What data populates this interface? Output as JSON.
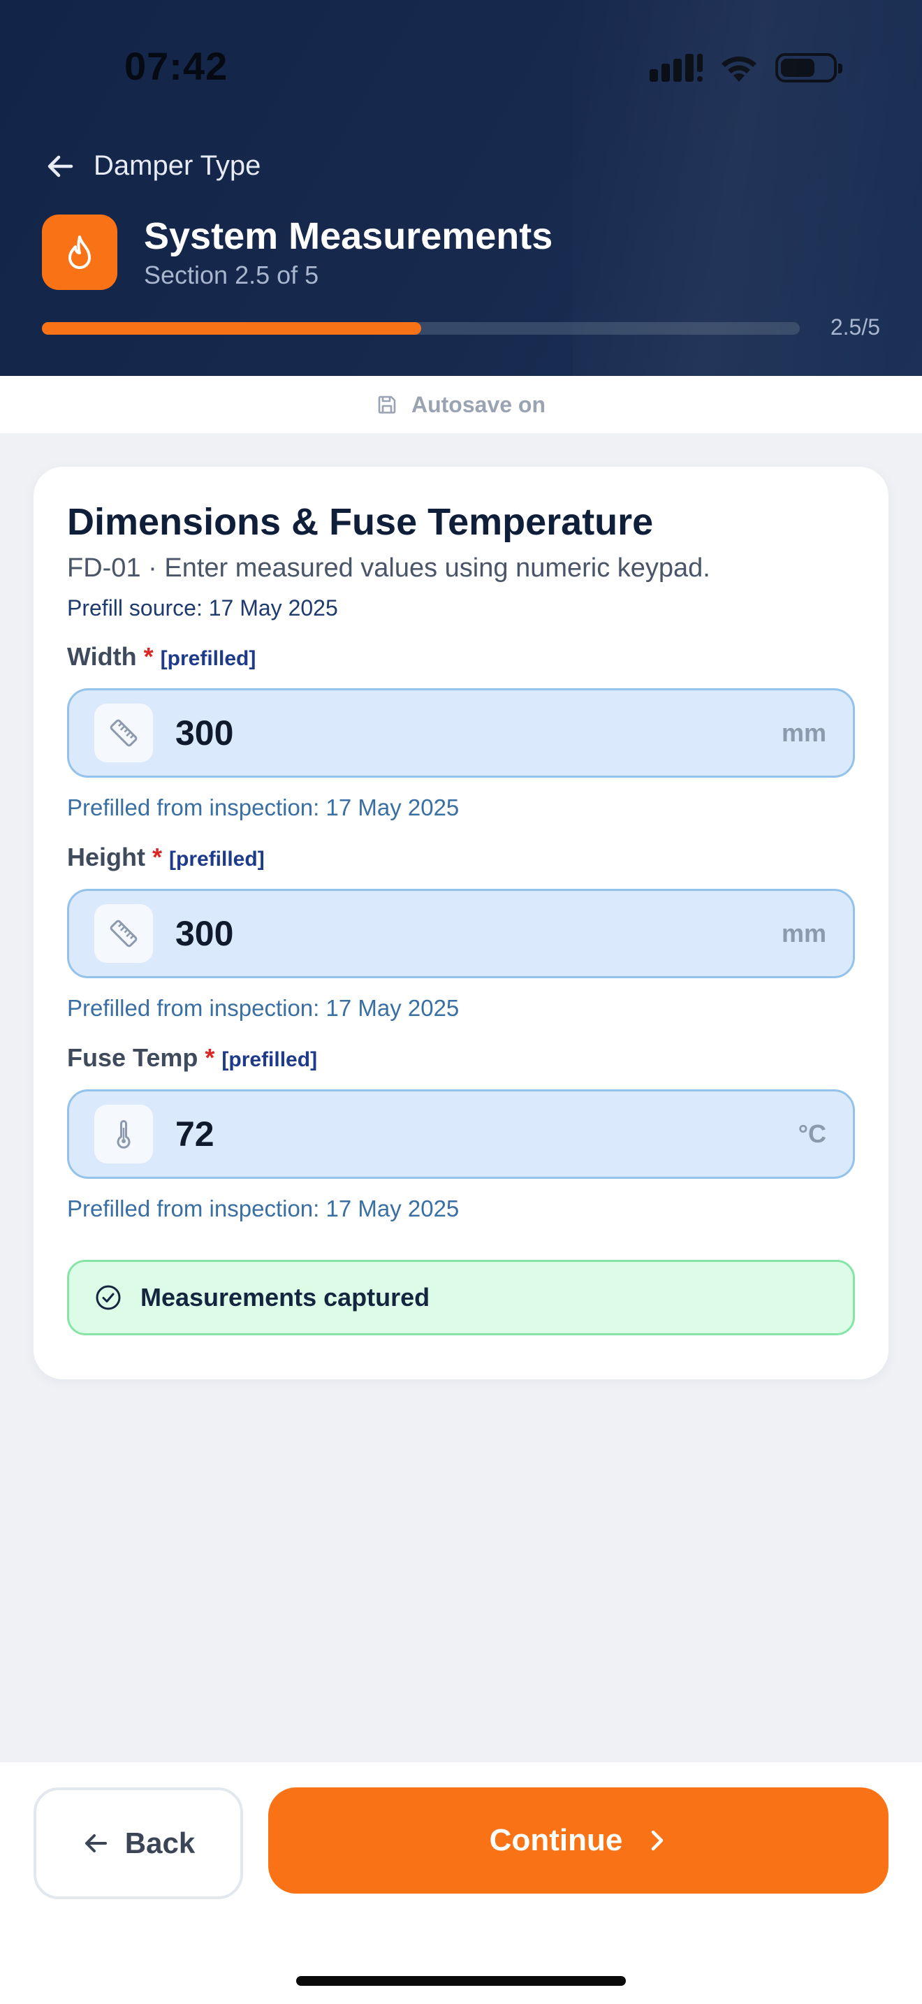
{
  "status_bar": {
    "time": "07:42"
  },
  "header": {
    "back_label": "Damper Type",
    "title": "System Measurements",
    "subtitle": "Section 2.5 of 5",
    "progress_label": "2.5/5",
    "progress_fraction": 0.5,
    "accent_color": "#f97316"
  },
  "autosave": {
    "label": "Autosave on"
  },
  "card": {
    "title": "Dimensions & Fuse Temperature",
    "subtitle": "FD-01 · Enter measured values using numeric keypad.",
    "prefill_source": "Prefill source: 17 May 2025",
    "fields": [
      {
        "label": "Width",
        "required": "*",
        "tag": "[prefilled]",
        "value": "300",
        "unit": "mm",
        "icon": "ruler-icon",
        "hint": "Prefilled from inspection: 17 May 2025"
      },
      {
        "label": "Height",
        "required": "*",
        "tag": "[prefilled]",
        "value": "300",
        "unit": "mm",
        "icon": "ruler-icon",
        "hint": "Prefilled from inspection: 17 May 2025"
      },
      {
        "label": "Fuse Temp",
        "required": "*",
        "tag": "[prefilled]",
        "value": "72",
        "unit": "°C",
        "icon": "thermometer-icon",
        "hint": "Prefilled from inspection: 17 May 2025"
      }
    ],
    "success_message": "Measurements captured"
  },
  "footer": {
    "back_label": "Back",
    "continue_label": "Continue"
  }
}
